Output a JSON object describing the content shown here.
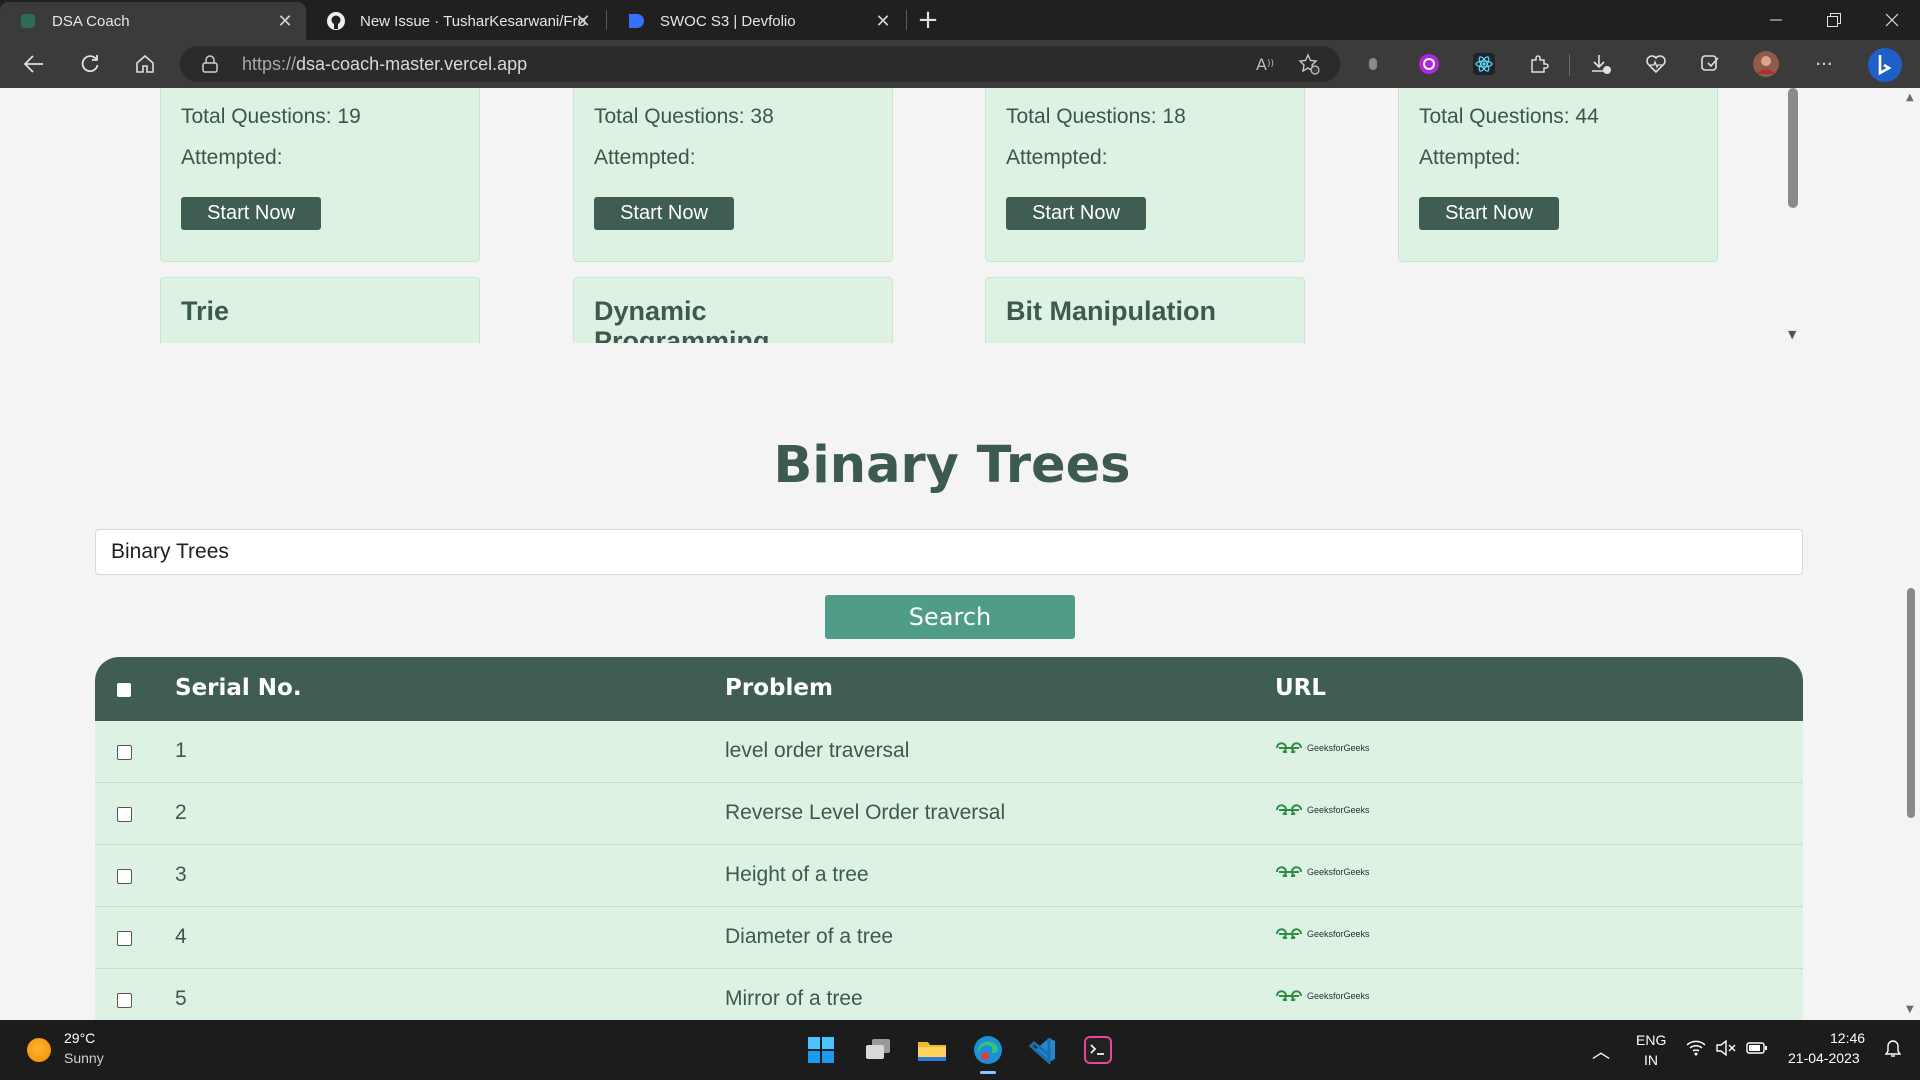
{
  "browser": {
    "tabs": [
      {
        "title": "DSA Coach",
        "active": true
      },
      {
        "title": "New Issue · TusharKesarwani/Fro",
        "active": false
      },
      {
        "title": "SWOC S3 | Devfolio",
        "active": false
      }
    ],
    "url": "https://dsa-coach-master.vercel.app",
    "url_prefix": "https://",
    "url_host": "dsa-coach-master.vercel.app"
  },
  "topic_cards": [
    {
      "total_label": "Total Questions: 19",
      "attempted_label": "Attempted:",
      "button": "Start Now"
    },
    {
      "total_label": "Total Questions: 38",
      "attempted_label": "Attempted:",
      "button": "Start Now"
    },
    {
      "total_label": "Total Questions: 18",
      "attempted_label": "Attempted:",
      "button": "Start Now"
    },
    {
      "total_label": "Total Questions: 44",
      "attempted_label": "Attempted:",
      "button": "Start Now"
    }
  ],
  "topic_cards_next": [
    {
      "title": "Trie"
    },
    {
      "title": "Dynamic Programming"
    },
    {
      "title": "Bit Manipulation"
    }
  ],
  "section": {
    "title": "Binary Trees",
    "search_value": "Binary Trees",
    "search_button": "Search"
  },
  "table": {
    "headers": {
      "serial": "Serial No.",
      "problem": "Problem",
      "url": "URL"
    },
    "rows": [
      {
        "serial": "1",
        "problem": "level order traversal",
        "site": "GeeksforGeeks"
      },
      {
        "serial": "2",
        "problem": "Reverse Level Order traversal",
        "site": "GeeksforGeeks"
      },
      {
        "serial": "3",
        "problem": "Height of a tree",
        "site": "GeeksforGeeks"
      },
      {
        "serial": "4",
        "problem": "Diameter of a tree",
        "site": "GeeksforGeeks"
      },
      {
        "serial": "5",
        "problem": "Mirror of a tree",
        "site": "GeeksforGeeks"
      }
    ]
  },
  "taskbar": {
    "weather_temp": "29°C",
    "weather_desc": "Sunny",
    "lang_top": "ENG",
    "lang_bottom": "IN",
    "time": "12:46",
    "date": "21-04-2023"
  },
  "colors": {
    "card_bg": "#ddf2e2",
    "header_green": "#3f5d52",
    "search_button": "#4f9c89",
    "title_text": "#3d5a4f"
  }
}
